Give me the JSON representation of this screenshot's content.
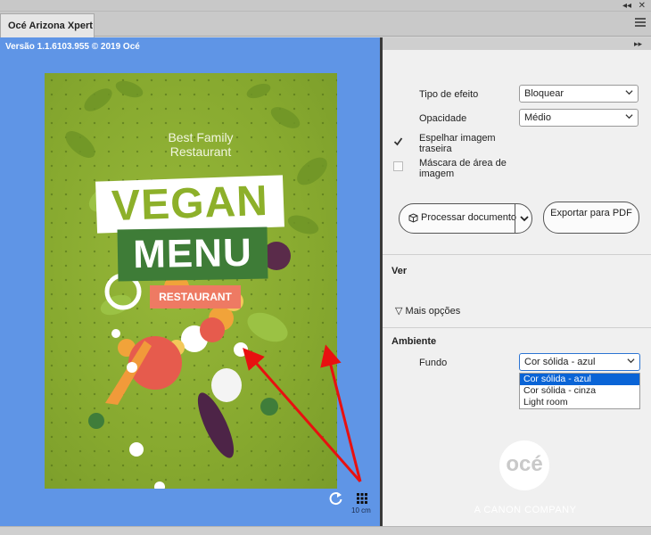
{
  "window": {
    "tab_title": "Océ Arizona Xpert"
  },
  "topbar": {
    "collapse_label": "◂◂",
    "close_label": "✕"
  },
  "preview": {
    "version_text": "Versão 1.1.6103.955 © 2019 Océ",
    "poster": {
      "subtitle": "Best Family Restaurant",
      "title1": "VEGAN",
      "title2": "MENU",
      "tagline": "RESTAURANT"
    },
    "scale_label": "10 cm"
  },
  "panel": {
    "expand_label": "▸▸",
    "effect_type_label": "Tipo de efeito",
    "effect_type_value": "Bloquear",
    "opacity_label": "Opacidade",
    "opacity_value": "Médio",
    "mirror_label": "Espelhar imagem traseira",
    "mirror_checked": true,
    "mask_label": "Máscara de área de imagem",
    "mask_checked": false,
    "process_button": "Processar documento",
    "export_button": "Exportar para PDF",
    "view_header": "Ver",
    "more_options": "Mais opções",
    "environment_header": "Ambiente",
    "background_label": "Fundo",
    "background_value": "Cor sólida - azul",
    "background_options": [
      "Cor sólida - azul",
      "Cor sólida - cinza",
      "Light room"
    ],
    "background_selected_index": 0,
    "logo_text": "océ",
    "company_text": "A CANON COMPANY"
  },
  "colors": {
    "preview_bg": "#5f95e6",
    "poster_green": "#87a92f",
    "vegan_green": "#8db02a",
    "menu_green": "#3e7c37",
    "restaurant_coral": "#ee7a63",
    "highlight_blue": "#0a64d6",
    "arrow_red": "#e81010"
  }
}
